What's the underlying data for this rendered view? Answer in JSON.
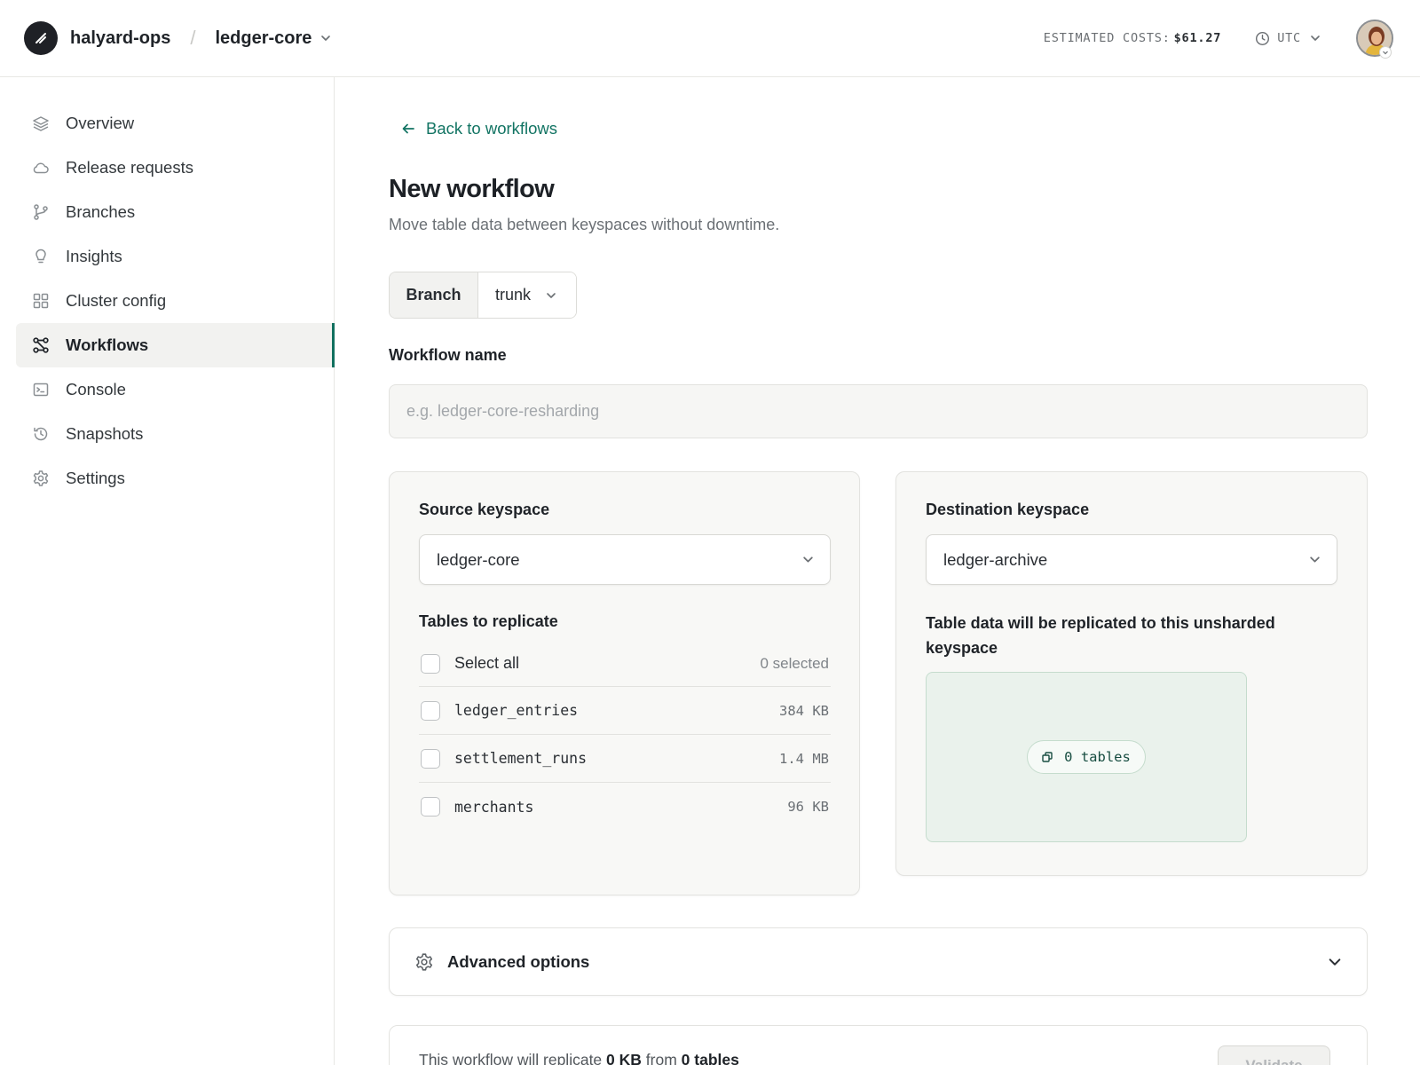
{
  "header": {
    "org_name": "halyard-ops",
    "separator": "/",
    "database_name": "ledger-core",
    "costs_label": "ESTIMATED COSTS:",
    "costs_amount": "$61.27",
    "timezone": "UTC"
  },
  "sidebar": {
    "items": [
      {
        "label": "Overview",
        "icon": "layers-icon"
      },
      {
        "label": "Release requests",
        "icon": "cloud-icon"
      },
      {
        "label": "Branches",
        "icon": "git-branch-icon"
      },
      {
        "label": "Insights",
        "icon": "lightbulb-icon"
      },
      {
        "label": "Cluster config",
        "icon": "grid-icon"
      },
      {
        "label": "Workflows",
        "icon": "workflow-icon",
        "active": true
      },
      {
        "label": "Console",
        "icon": "terminal-icon"
      },
      {
        "label": "Snapshots",
        "icon": "history-icon"
      },
      {
        "label": "Settings",
        "icon": "gear-icon"
      }
    ]
  },
  "main": {
    "back_link": "Back to workflows",
    "title": "New workflow",
    "subtitle": "Move table data between keyspaces without downtime.",
    "branch_label": "Branch",
    "branch_value": "trunk",
    "workflow_name_label": "Workflow name",
    "workflow_name_placeholder": "e.g. ledger-core-resharding",
    "workflow_name_value": "",
    "source": {
      "label": "Source keyspace",
      "value": "ledger-core",
      "tables_title": "Tables to replicate",
      "select_all_label": "Select all",
      "selected_count": "0 selected",
      "tables": [
        {
          "name": "ledger_entries",
          "size": "384 KB",
          "checked": false
        },
        {
          "name": "settlement_runs",
          "size": "1.4 MB",
          "checked": false
        },
        {
          "name": "merchants",
          "size": "96 KB",
          "checked": false
        }
      ]
    },
    "destination": {
      "label": "Destination keyspace",
      "value": "ledger-archive",
      "description": "Table data will be replicated to this unsharded keyspace",
      "tables_pill": "0 tables"
    },
    "advanced_label": "Advanced options",
    "footer": {
      "text_prefix": "This workflow will replicate",
      "size": "0 KB",
      "text_mid": "from",
      "count": "0 tables",
      "validate_label": "Validate"
    }
  },
  "colors": {
    "accent": "#11705f",
    "dropzone_bg": "#eaf2ec",
    "text_primary": "#1f2328"
  }
}
